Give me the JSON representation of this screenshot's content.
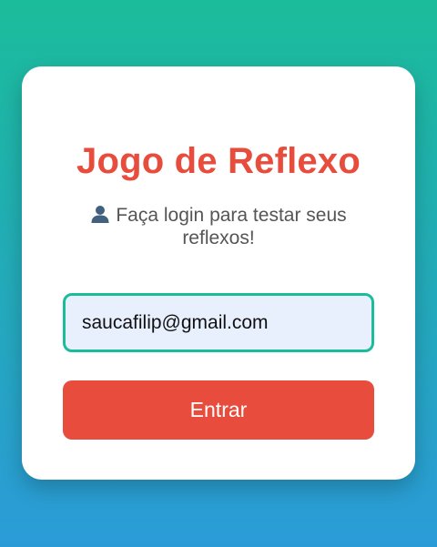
{
  "login": {
    "title": "Jogo de Reflexo",
    "subtitle": "Faça login para testar seus reflexos!",
    "email_value": "saucafilip@gmail.com",
    "submit_label": "Entrar",
    "icon": "user-icon"
  },
  "colors": {
    "accent": "#e74c3c",
    "input_border": "#1abc9c",
    "input_background": "#e8f0fe",
    "background_top": "#1bbc9b",
    "background_bottom": "#2b9bd8"
  }
}
